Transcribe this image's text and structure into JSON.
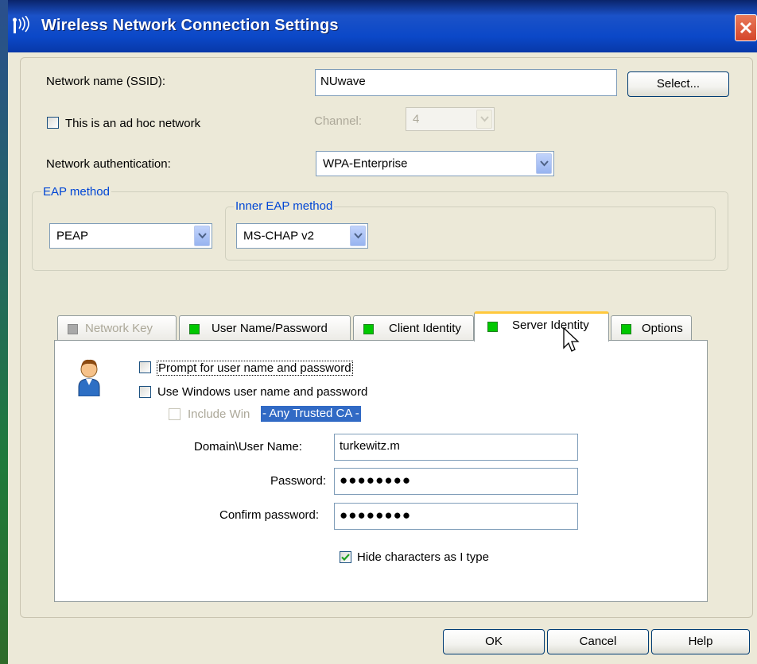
{
  "window": {
    "title": "Wireless Network Connection Settings"
  },
  "ssid": {
    "label": "Network name (SSID):",
    "value": "NUwave",
    "select_button": "Select..."
  },
  "adhoc": {
    "label": "This is an ad hoc network",
    "checked": false,
    "channel_label": "Channel:",
    "channel_value": "4"
  },
  "auth": {
    "label": "Network authentication:",
    "value": "WPA-Enterprise"
  },
  "eap": {
    "legend": "EAP method",
    "value": "PEAP",
    "inner_legend": "Inner EAP method",
    "inner_value": "MS-CHAP v2"
  },
  "tabs": [
    {
      "label": "Network Key",
      "status": "gray",
      "disabled": true
    },
    {
      "label": "User Name/Password",
      "status": "green"
    },
    {
      "label": "Client Identity",
      "status": "green"
    },
    {
      "label": "Server Identity",
      "status": "green",
      "active": true
    },
    {
      "label": "Options",
      "status": "green"
    }
  ],
  "credentials": {
    "prompt_label": "Prompt for user name and password",
    "prompt_checked": false,
    "windows_label": "Use Windows user name and password",
    "windows_checked": false,
    "include_label": "Include Win",
    "overlay_text": "- Any Trusted CA -",
    "username_label": "Domain\\User Name:",
    "username_value": "turkewitz.m",
    "password_label": "Password:",
    "password_value": "●●●●●●●●",
    "confirm_label": "Confirm password:",
    "confirm_value": "●●●●●●●●",
    "hide_label": "Hide characters as I type",
    "hide_checked": true
  },
  "buttons": {
    "ok": "OK",
    "cancel": "Cancel",
    "help": "Help"
  },
  "colors": {
    "title_bar": "#0b48c8",
    "accent": "#0046d5",
    "selection": "#316ac5",
    "tab_status": "#00c800"
  }
}
